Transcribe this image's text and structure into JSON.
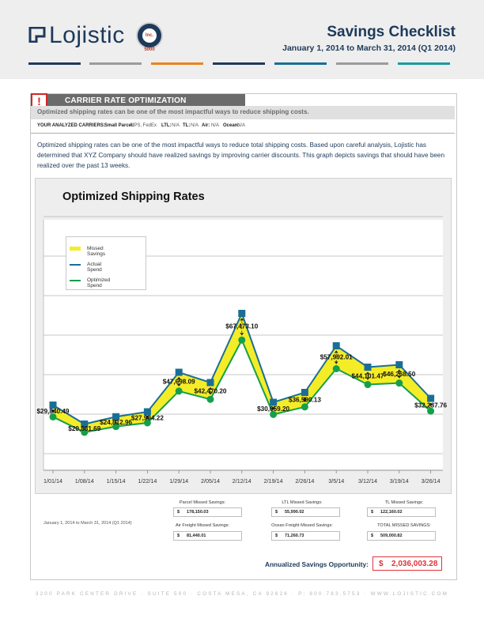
{
  "brand": {
    "name": "Lojistic",
    "seal_text": "Inc. 5000"
  },
  "doc": {
    "title": "Savings Checklist",
    "subtitle": "January 1, 2014 to March 31, 2014 (Q1 2014)"
  },
  "colors": {
    "brand_navy": "#1d3a5a",
    "missed": "#f5ec28",
    "actual": "#1a6e96",
    "optimized": "#14a04a",
    "alert": "#d0262a",
    "stripes": [
      "#1d3a5a",
      "#9b9b9b",
      "#e8851e",
      "#1d3a5a",
      "#1a6e96",
      "#9b9b9b",
      "#1a9aa0"
    ]
  },
  "section": {
    "title": "CARRIER RATE OPTIMIZATION",
    "alert_icon": "!",
    "tagline": "Optimized shipping rates can be one of the most impactful ways to reduce shipping costs.",
    "carriers_label": "YOUR ANALYZED CARRIERS:",
    "carriers": [
      {
        "label": "Small Parcel:",
        "value": "UPS, FedEx"
      },
      {
        "label": "LTL:",
        "value": "N/A"
      },
      {
        "label": "TL:",
        "value": "N/A"
      },
      {
        "label": "Air:",
        "value": "N/A"
      },
      {
        "label": "Ocean:",
        "value": "N/A"
      }
    ],
    "paragraph": "Optimized shipping rates can be one of the most impactful ways to reduce total shipping costs. Based upon careful analysis, Lojistic has determined that XYZ Company should have realized savings by improving carrier discounts. This graph depicts savings that should have been realized over the past 13 weeks."
  },
  "chart_data": {
    "type": "line",
    "title": "Optimized Shipping Rates",
    "categories": [
      "1/01/14",
      "1/08/14",
      "1/15/14",
      "1/22/14",
      "1/29/14",
      "2/05/14",
      "2/12/14",
      "2/19/14",
      "2/26/14",
      "3/5/14",
      "3/12/14",
      "3/19/14",
      "3/26/14"
    ],
    "series": [
      {
        "name": "Actual Spend",
        "values": [
          123000,
          75000,
          93500,
          106000,
          206000,
          180000,
          355000,
          130000,
          155000,
          273000,
          219000,
          225000,
          140000
        ]
      },
      {
        "name": "Optimized Spend",
        "values": [
          93160,
          54139,
          68687,
          78006,
          158302,
          137530,
          287527,
          99341,
          118410,
          215008,
          174899,
          178732,
          107762
        ]
      }
    ],
    "missed_savings_name": "Missed Savings",
    "missed_savings_labels": [
      "$29,840.49",
      "$20,861.69",
      "$24,812.96",
      "$27,994.22",
      "$47,698.09",
      "$42,470.20",
      "$67,473.10",
      "$30,659.20",
      "$36,590.13",
      "$57,992.01",
      "$44,101.47",
      "$46,268.50",
      "$32,237.76"
    ],
    "legend": [
      "Missed Savings",
      "Actual Spend",
      "Optimized Spend"
    ],
    "legend_placement": "top-left",
    "grid": true
  },
  "summary": {
    "period": "January 1, 2014 to March 31, 2014 (Q1 2014)",
    "currency": "$",
    "items": [
      {
        "label": "Parcel Missed Savings:",
        "value": "178,150.03"
      },
      {
        "label": "LTL Missed Savings:",
        "value": "55,990.02"
      },
      {
        "label": "TL Missed Savings:",
        "value": "122,160.02"
      },
      {
        "label": "Air Freight Missed Savings:",
        "value": "81,440.01"
      },
      {
        "label": "Ocean Freight Missed Savings:",
        "value": "71,260.73"
      },
      {
        "label": "TOTAL MISSED SAVINGS:",
        "value": "509,000.82"
      }
    ],
    "annualized_label": "Annualized Savings Opportunity:",
    "annualized_value": "2,036,003.28"
  },
  "footer": "3200 PARK CENTER DRIVE  ·  SUITE 500  ·  COSTA MESA, CA 92626  ·  P: 800.783.5753  ·  WWW.LOJISTIC.COM"
}
